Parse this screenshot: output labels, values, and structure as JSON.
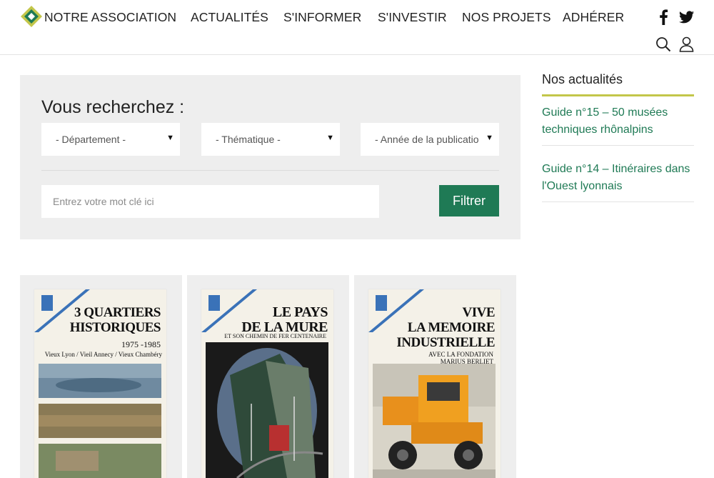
{
  "header": {
    "nav": [
      {
        "label": "NOTRE ASSOCIATION"
      },
      {
        "label": "ACTUALITÉS"
      },
      {
        "label": "S'INFORMER"
      },
      {
        "label": "S'INVESTIR"
      },
      {
        "label": "NOS PROJETS"
      },
      {
        "label": "ADHÉRER"
      }
    ],
    "social_icons": [
      "facebook-icon",
      "twitter-icon"
    ],
    "utility_icons": [
      "search-icon",
      "user-icon"
    ]
  },
  "search": {
    "title": "Vous recherchez :",
    "departement": "- Département -",
    "thematique": "- Thématique -",
    "annee": "- Année de la publicatio",
    "keyword_placeholder": "Entrez votre mot clé ici",
    "filter_label": "Filtrer"
  },
  "sidebar": {
    "title": "Nos actualités",
    "items": [
      {
        "label": "Guide n°15 – 50 musées techniques rhônalpins"
      },
      {
        "label": "Guide n°14 – Itinéraires dans l'Ouest lyonnais"
      }
    ]
  },
  "cards": [
    {
      "title_lines": [
        "3 QUARTIERS",
        "HISTORIQUES"
      ],
      "years": "1975 -1985",
      "subtitle": "Vieux Lyon / Vieil Annecy / Vieux Chambéry"
    },
    {
      "title_lines": [
        "LE PAYS",
        "DE LA MURE"
      ],
      "subtitle": "ET SON CHEMIN DE FER CENTENAIRE"
    },
    {
      "title_lines": [
        "VIVE",
        "LA MEMOIRE",
        "INDUSTRIELLE"
      ],
      "subtitle": "AVEC LA FONDATION",
      "subtitle2": "MARIUS BERLIET"
    }
  ],
  "colors": {
    "accent_green": "#1f7a55",
    "accent_lime": "#c3c64a",
    "panel_gray": "#eeeeee"
  }
}
